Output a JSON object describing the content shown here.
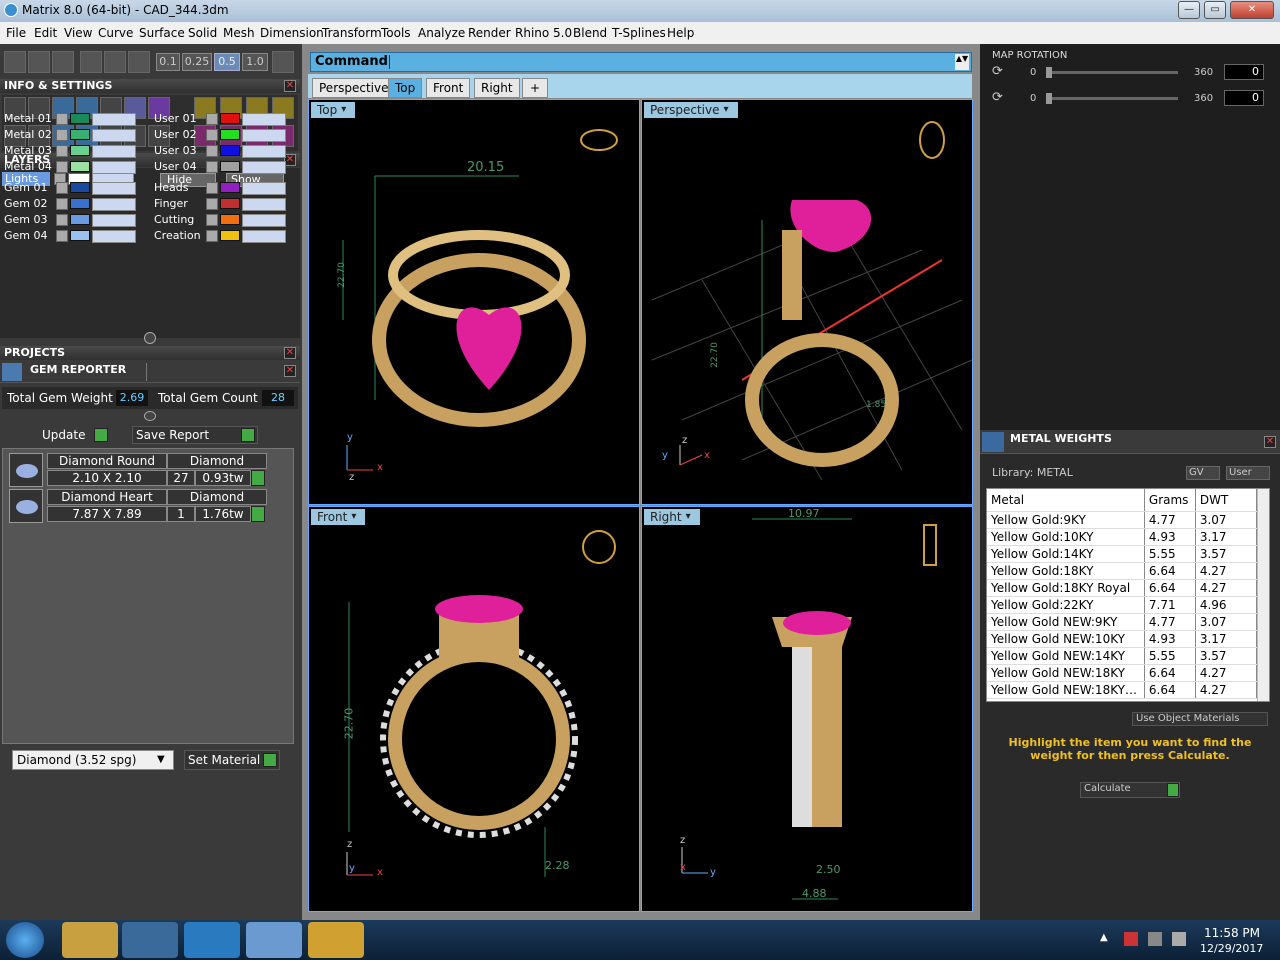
{
  "window": {
    "title": "Matrix 8.0 (64-bit) - CAD_344.3dm",
    "minimize": "—",
    "maximize": "▭",
    "close": "✕"
  },
  "menu": [
    "File",
    "Edit",
    "View",
    "Curve",
    "Surface",
    "Solid",
    "Mesh",
    "Dimension",
    "Transform",
    "Tools",
    "Analyze",
    "Render",
    "Rhino 5.0",
    "Blend",
    "T-Splines",
    "Help"
  ],
  "toolbar": {
    "snap_values": [
      "0.1",
      "0.25",
      "0.5",
      "1.0"
    ]
  },
  "info_settings": {
    "title": "INFO & SETTINGS"
  },
  "layers": {
    "title": "LAYERS",
    "lights": "Lights",
    "hide": "Hide",
    "show": "Show",
    "left": [
      {
        "name": "Metal 01",
        "color": "#1a8a5a"
      },
      {
        "name": "Metal 02",
        "color": "#3ab070"
      },
      {
        "name": "Metal 03",
        "color": "#6ad090"
      },
      {
        "name": "Metal 04",
        "color": "#9ae0a0"
      },
      {
        "name": "Gem 01",
        "color": "#1a4aa0"
      },
      {
        "name": "Gem 02",
        "color": "#3a70d0"
      },
      {
        "name": "Gem 03",
        "color": "#6a9ae0"
      },
      {
        "name": "Gem 04",
        "color": "#9ac0f0"
      }
    ],
    "right": [
      {
        "name": "User 01",
        "color": "#e01010"
      },
      {
        "name": "User 02",
        "color": "#20e020"
      },
      {
        "name": "User 03",
        "color": "#1010e0"
      },
      {
        "name": "User 04",
        "color": "#a0a0a0"
      },
      {
        "name": "Heads",
        "color": "#9020c0"
      },
      {
        "name": "Finger",
        "color": "#c03030"
      },
      {
        "name": "Cutting",
        "color": "#f07010"
      },
      {
        "name": "Creation",
        "color": "#f0c010"
      }
    ]
  },
  "projects": {
    "title": "PROJECTS"
  },
  "gem_reporter": {
    "title": "GEM REPORTER",
    "total_weight_label": "Total Gem Weight",
    "total_weight": "2.69",
    "total_count_label": "Total Gem Count",
    "total_count": "28",
    "update": "Update",
    "save_report": "Save Report",
    "gems": [
      {
        "name": "Diamond Round",
        "type": "Diamond",
        "size": "2.10 X 2.10",
        "count": "27",
        "weight": "0.93tw"
      },
      {
        "name": "Diamond Heart",
        "type": "Diamond",
        "size": "7.87 X 7.89",
        "count": "1",
        "weight": "1.76tw"
      }
    ],
    "material_select": "Diamond    (3.52 spg)",
    "set_material": "Set Material"
  },
  "command": {
    "label": "Command:"
  },
  "view_tabs": [
    "Perspective",
    "Top",
    "Front",
    "Right",
    "+"
  ],
  "viewports": {
    "top": {
      "label": "Top",
      "dim1": "20.15",
      "dim2": "22.70"
    },
    "perspective": {
      "label": "Perspective",
      "dim1": "22.70",
      "dim2": "1.85"
    },
    "front": {
      "label": "Front",
      "dim1": "22.70",
      "dim2": "2.28"
    },
    "right": {
      "label": "Right",
      "dim1": "10.97",
      "dim2": "2.50",
      "dim3": "4.88"
    }
  },
  "axes": {
    "x": "x",
    "y": "y",
    "z": "z"
  },
  "map_rotation": {
    "title": "MAP ROTATION",
    "rows": [
      {
        "min": "0",
        "max": "360",
        "value": "0"
      },
      {
        "min": "0",
        "max": "360",
        "value": "0"
      }
    ]
  },
  "metal_weights": {
    "title": "METAL WEIGHTS",
    "library": "Library: METAL",
    "gv": "GV",
    "user": "User",
    "headers": [
      "Metal",
      "Grams",
      "DWT"
    ],
    "rows": [
      [
        "Yellow Gold:9KY",
        "4.77",
        "3.07"
      ],
      [
        "Yellow Gold:10KY",
        "4.93",
        "3.17"
      ],
      [
        "Yellow Gold:14KY",
        "5.55",
        "3.57"
      ],
      [
        "Yellow Gold:18KY",
        "6.64",
        "4.27"
      ],
      [
        "Yellow Gold:18KY Royal",
        "6.64",
        "4.27"
      ],
      [
        "Yellow Gold:22KY",
        "7.71",
        "4.96"
      ],
      [
        "Yellow Gold NEW:9KY",
        "4.77",
        "3.07"
      ],
      [
        "Yellow Gold NEW:10KY",
        "4.93",
        "3.17"
      ],
      [
        "Yellow Gold NEW:14KY",
        "5.55",
        "3.57"
      ],
      [
        "Yellow Gold NEW:18KY",
        "6.64",
        "4.27"
      ],
      [
        "Yellow Gold NEW:18KY…",
        "6.64",
        "4.27"
      ]
    ],
    "use_object_materials": "Use Object Materials",
    "hint": "Highlight the item you want to find the weight for then press Calculate.",
    "calculate": "Calculate"
  },
  "taskbar": {
    "time": "11:58 PM",
    "date": "12/29/2017"
  }
}
